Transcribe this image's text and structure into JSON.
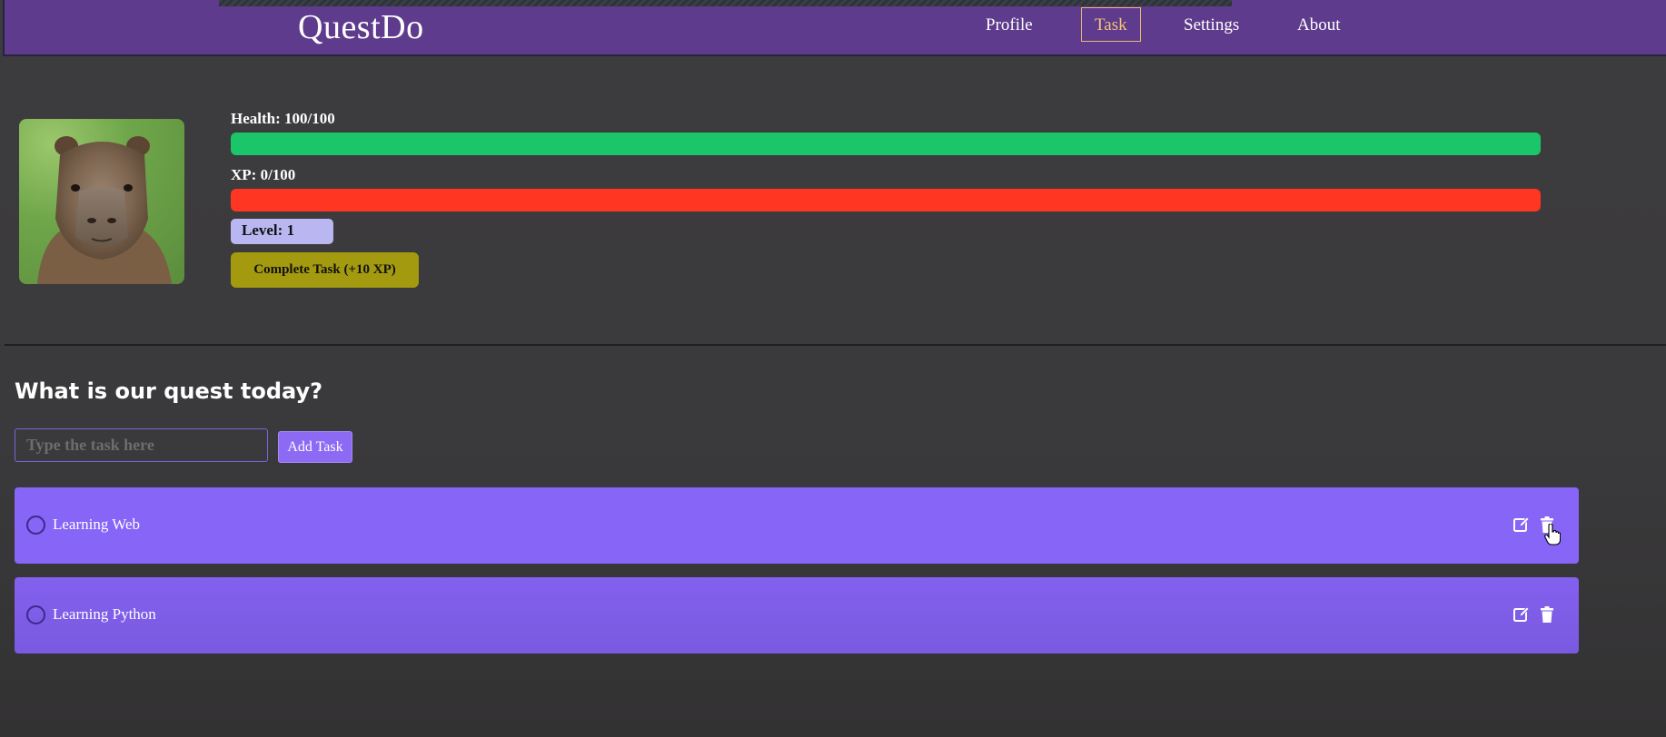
{
  "header": {
    "brand": "QuestDo",
    "nav": [
      {
        "label": "Profile"
      },
      {
        "label": "Task",
        "active": true
      },
      {
        "label": "Settings"
      },
      {
        "label": "About"
      }
    ]
  },
  "profile": {
    "health_label": "Health: 100/100",
    "health_fraction": 1.0,
    "xp_label": "XP: 0/100",
    "xp_fraction": 0.0,
    "level_label": "Level: 1",
    "complete_button": "Complete Task (+10 XP)"
  },
  "quest": {
    "title": "What is our quest today?",
    "input_placeholder": "Type the task here",
    "input_value": "",
    "add_button": "Add Task",
    "tasks": [
      {
        "text": "Learning Web",
        "done": false
      },
      {
        "text": "Learning Python",
        "done": false
      }
    ]
  },
  "icons": {
    "edit": "edit-icon",
    "delete": "trash-icon",
    "checkbox": "circle-icon"
  },
  "colors": {
    "header_bg": "#5e3b8c",
    "active_nav": "#f3c27a",
    "health_bar": "#1bc66a",
    "xp_bar": "#ff3621",
    "level_badge": "#b9b6f1",
    "complete_button": "#a39a0f",
    "task_row": "#8665f7",
    "add_button": "#8c6af4"
  }
}
